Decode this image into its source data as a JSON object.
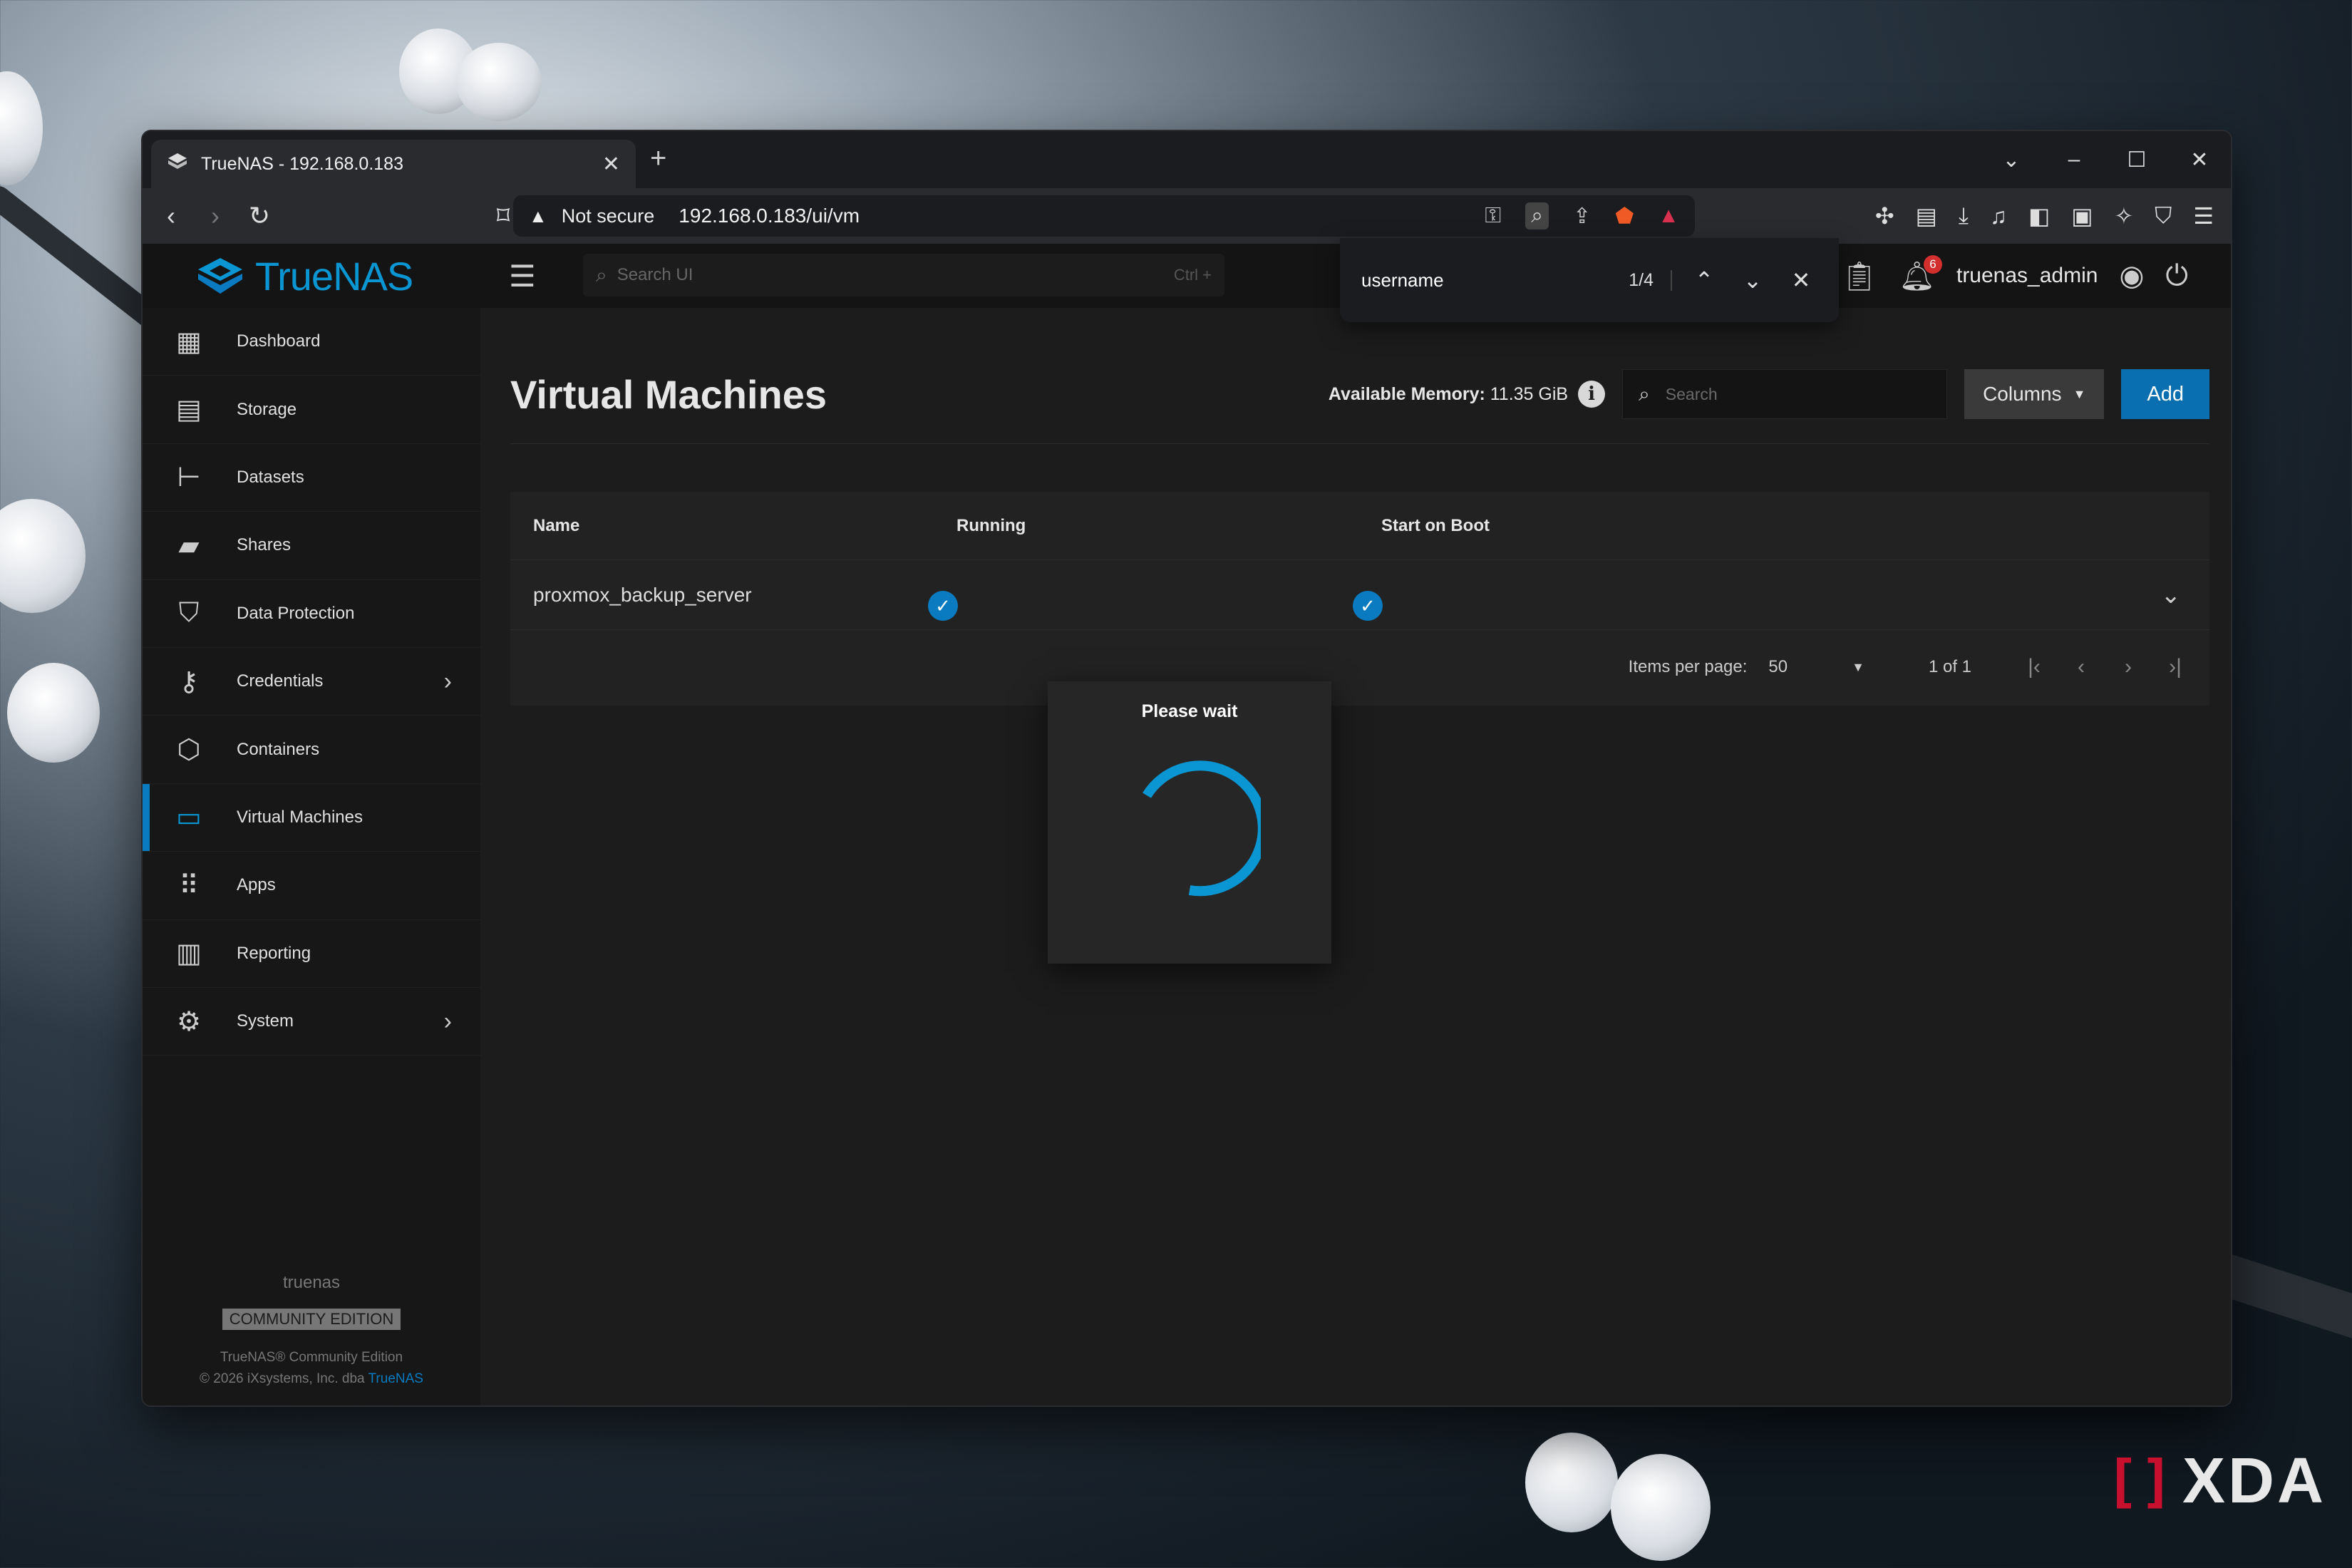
{
  "browser": {
    "tab_title": "TrueNAS - 192.168.0.183",
    "new_tab_icon": "+",
    "address": {
      "security_label": "Not secure",
      "url": "192.168.0.183/ui/vm"
    },
    "find_bar": {
      "query": "username",
      "match_count": "1/4"
    }
  },
  "app": {
    "brand": "TrueNAS",
    "global_search_placeholder": "Search UI",
    "global_search_shortcut": "Ctrl +",
    "notification_count": "6",
    "username": "truenas_admin",
    "sidebar": {
      "items": [
        {
          "label": "Dashboard",
          "icon": "dashboard-icon"
        },
        {
          "label": "Storage",
          "icon": "storage-icon"
        },
        {
          "label": "Datasets",
          "icon": "datasets-icon"
        },
        {
          "label": "Shares",
          "icon": "shares-icon"
        },
        {
          "label": "Data Protection",
          "icon": "shield-icon"
        },
        {
          "label": "Credentials",
          "icon": "key-icon"
        },
        {
          "label": "Containers",
          "icon": "cube-icon"
        },
        {
          "label": "Virtual Machines",
          "icon": "laptop-icon"
        },
        {
          "label": "Apps",
          "icon": "grid-icon"
        },
        {
          "label": "Reporting",
          "icon": "chart-icon"
        },
        {
          "label": "System",
          "icon": "gear-icon"
        }
      ],
      "footer": {
        "hostname": "truenas",
        "edition_badge": "COMMUNITY EDITION",
        "copyright_line1": "TrueNAS® Community Edition",
        "copyright_line2": "© 2026 iXsystems, Inc. dba",
        "copyright_link": "TrueNAS"
      }
    },
    "main": {
      "title": "Virtual Machines",
      "available_memory_label": "Available Memory:",
      "available_memory_value": "11.35 GiB",
      "search_placeholder": "Search",
      "columns_button": "Columns",
      "add_button": "Add",
      "table": {
        "headers": [
          "Name",
          "Running",
          "Start on Boot"
        ],
        "rows": [
          {
            "name": "proxmox_backup_server",
            "running": true,
            "start_on_boot": true
          }
        ],
        "items_per_page_label": "Items per page:",
        "items_per_page_value": "50",
        "range_label": "1 of 1"
      },
      "dialog": {
        "title": "Please wait"
      }
    }
  },
  "watermark": "XDA",
  "colors": {
    "accent": "#0a95d3",
    "add_button": "#0a6fb0",
    "badge": "#d32f2f"
  }
}
